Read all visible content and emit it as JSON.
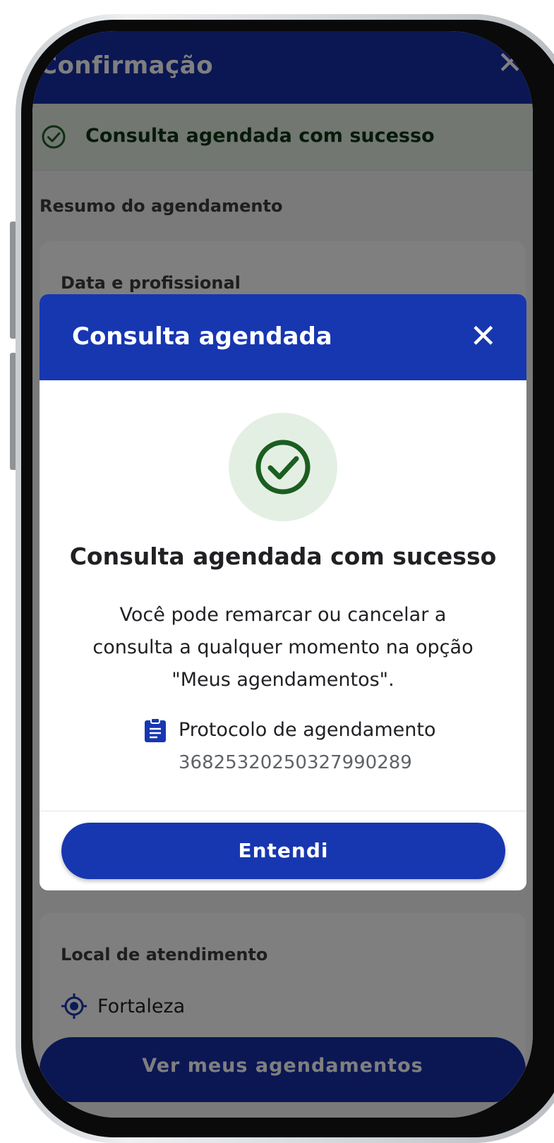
{
  "page": {
    "title": "Confirmação",
    "success_banner": "Consulta agendada com sucesso",
    "summary_title": "Resumo do agendamento",
    "card_date_title": "Data e profissional",
    "card_location_title": "Local de atendimento",
    "location_city": "Fortaleza",
    "bottom_button": "Ver meus agendamentos"
  },
  "dialog": {
    "title": "Consulta agendada",
    "heading": "Consulta agendada com sucesso",
    "message": "Você pode remarcar ou cancelar a consulta a qualquer momento na opção \"Meus agendamentos\".",
    "protocol_label": "Protocolo de agendamento",
    "protocol_number": "36825320250327990289",
    "button": "Entendi"
  },
  "colors": {
    "primary": "#1737b0",
    "success_bg": "#e4efe4",
    "success_icon": "#1b5e20"
  }
}
